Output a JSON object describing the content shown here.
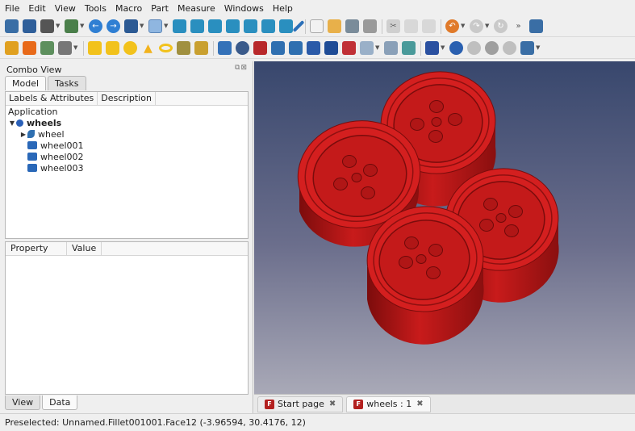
{
  "menu": [
    "File",
    "Edit",
    "View",
    "Tools",
    "Macro",
    "Part",
    "Measure",
    "Windows",
    "Help"
  ],
  "toolbar_icons": {
    "row1": [
      "zoom-fit-icon",
      "zoom-selection-icon",
      "draw-style-icon",
      "std-view-icon",
      "back-icon",
      "forward-icon",
      "view-menu-icon",
      "zoom-icon",
      "isometric-icon",
      "front-view-icon",
      "top-view-icon",
      "right-view-icon",
      "rear-view-icon",
      "bottom-view-icon",
      "left-view-icon",
      "measure-icon",
      "new-file-icon",
      "open-file-icon",
      "save-file-icon",
      "print-icon",
      "cut-icon",
      "copy-icon",
      "paste-icon",
      "undo-icon",
      "redo-icon",
      "refresh-icon",
      "more-icon"
    ],
    "row2": [
      "workbench-icon",
      "part-icon",
      "link-icon",
      "group-icon",
      "box-icon",
      "cylinder-icon",
      "sphere-icon",
      "cone-icon",
      "torus-icon",
      "tube-icon",
      "primitives-icon",
      "extrude-icon",
      "revolve-icon",
      "mirror-icon",
      "fillet-icon",
      "chamfer-icon",
      "face-icon",
      "ruled-surface-icon",
      "loft-icon",
      "sweep-icon",
      "section-icon",
      "cross-sections-icon",
      "offset-icon",
      "thickness-icon",
      "boolean-icon",
      "cut-boolean-icon",
      "fuse-icon",
      "common-icon",
      "compound-icon",
      "more-tools-icon"
    ]
  },
  "combo": {
    "title": "Combo View",
    "tabs": [
      "Model",
      "Tasks"
    ],
    "tree_headers": [
      "Labels & Attributes",
      "Description"
    ],
    "section": "Application",
    "tree": [
      {
        "label": "wheels",
        "bold": true
      },
      {
        "label": "wheel",
        "bold": false
      },
      {
        "label": "wheel001",
        "bold": false
      },
      {
        "label": "wheel002",
        "bold": false
      },
      {
        "label": "wheel003",
        "bold": false
      }
    ],
    "prop_headers": [
      "Property",
      "Value"
    ],
    "bottom_tabs": [
      "View",
      "Data"
    ]
  },
  "view_tabs": [
    {
      "label": "Start page",
      "close": "✖"
    },
    {
      "label": "wheels : 1",
      "close": "✖"
    }
  ],
  "status": "Preselected: Unnamed.Fillet001001.Face12 (-3.96594, 30.4176, 12)",
  "colors": {
    "wheel": "#d41f1f",
    "wheel_dark": "#8e1010",
    "fc_icon": "#b3201f",
    "bg_top": "#38476d",
    "bg_bottom": "#a9a9b7"
  }
}
